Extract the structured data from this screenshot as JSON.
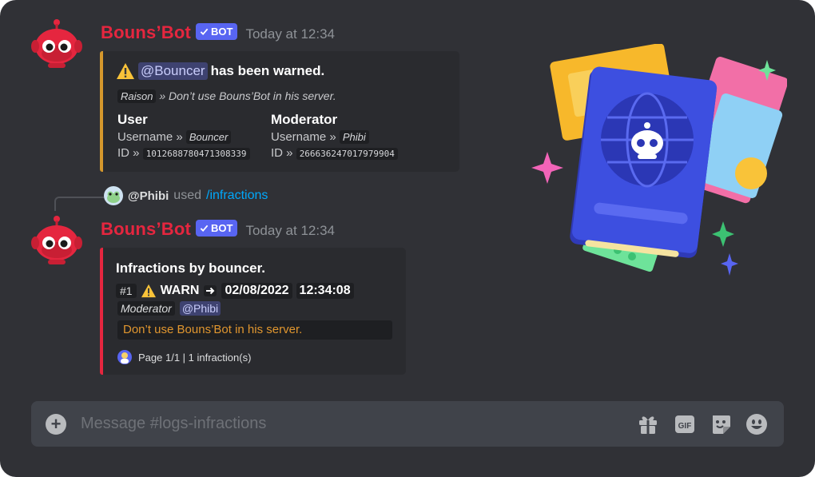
{
  "messages": [
    {
      "author": "Bouns’Bot",
      "tag": "BOT",
      "timestamp": "Today at 12:34",
      "embed": {
        "mention": "@Bouncer",
        "title_rest": "has been warned.",
        "reason_label": "Raison",
        "reason_text": "» Don’t use Bouns’Bot in his server.",
        "fields": [
          {
            "title": "User",
            "username_label": "Username »",
            "username": "Bouncer",
            "id_label": "ID »",
            "id": "1012688780471308339"
          },
          {
            "title": "Moderator",
            "username_label": "Username »",
            "username": "Phibi",
            "id_label": "ID »",
            "id": "266636247017979904"
          }
        ]
      }
    },
    {
      "author": "Bouns’Bot",
      "tag": "BOT",
      "timestamp": "Today at 12:34",
      "reply": {
        "user": "@Phibi",
        "used": "used",
        "command": "/infractions"
      },
      "embed": {
        "title": "Infractions by bouncer.",
        "number": "#1",
        "type": "WARN",
        "date": "02/08/2022",
        "time": "12:34:08",
        "moderator_label": "Moderator",
        "moderator_mention": "@Phibi",
        "reason": "Don’t use Bouns’Bot in his server.",
        "footer": "Page 1/1 | 1 infraction(s)"
      }
    }
  ],
  "composer": {
    "placeholder": "Message #logs-infractions",
    "icons": [
      "add-icon",
      "gift-icon",
      "gif-icon",
      "sticker-icon",
      "emoji-icon"
    ]
  },
  "colors": {
    "background": "#303136",
    "bot_name": "#e5263f",
    "bot_tag": "#5865f2",
    "warn_accent": "#d4972c",
    "infraction_accent": "#e5263f",
    "command_link": "#00a8fc"
  }
}
